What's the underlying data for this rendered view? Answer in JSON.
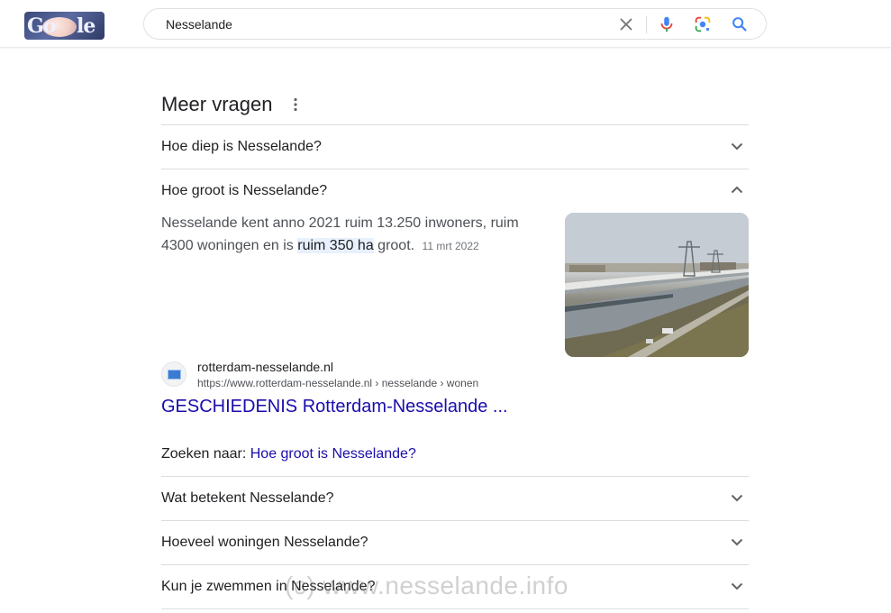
{
  "header": {
    "logo_text_left": "Go",
    "logo_text_right": "le",
    "search_query": "Nesselande"
  },
  "section": {
    "title": "Meer vragen",
    "questions_top": [
      {
        "label": "Hoe diep is Nesselande?",
        "expanded": false
      },
      {
        "label": "Hoe groot is Nesselande?",
        "expanded": true
      }
    ],
    "answer": {
      "text_before": "Nesselande kent anno 2021 ruim 13.250 inwoners, ruim 4300 woningen en is ",
      "highlight": "ruim 350 ha",
      "text_after": " groot.",
      "date": "11 mrt 2022"
    },
    "source": {
      "site_name": "rotterdam-nesselande.nl",
      "url": "https://www.rotterdam-nesselande.nl › nesselande › wonen",
      "title": "GESCHIEDENIS Rotterdam-Nesselande ..."
    },
    "search_for": {
      "label": "Zoeken naar:",
      "link": "Hoe groot is Nesselande?"
    },
    "questions_bottom": [
      {
        "label": "Wat betekent Nesselande?",
        "expanded": false
      },
      {
        "label": "Hoeveel woningen Nesselande?",
        "expanded": false
      },
      {
        "label": "Kun je zwemmen in Nesselande?",
        "expanded": false
      }
    ]
  },
  "watermark": "(c) www.nesselande.info",
  "colors": {
    "link": "#1a0dab",
    "highlight_bg": "#e8f0fe",
    "divider": "#dadce0"
  }
}
